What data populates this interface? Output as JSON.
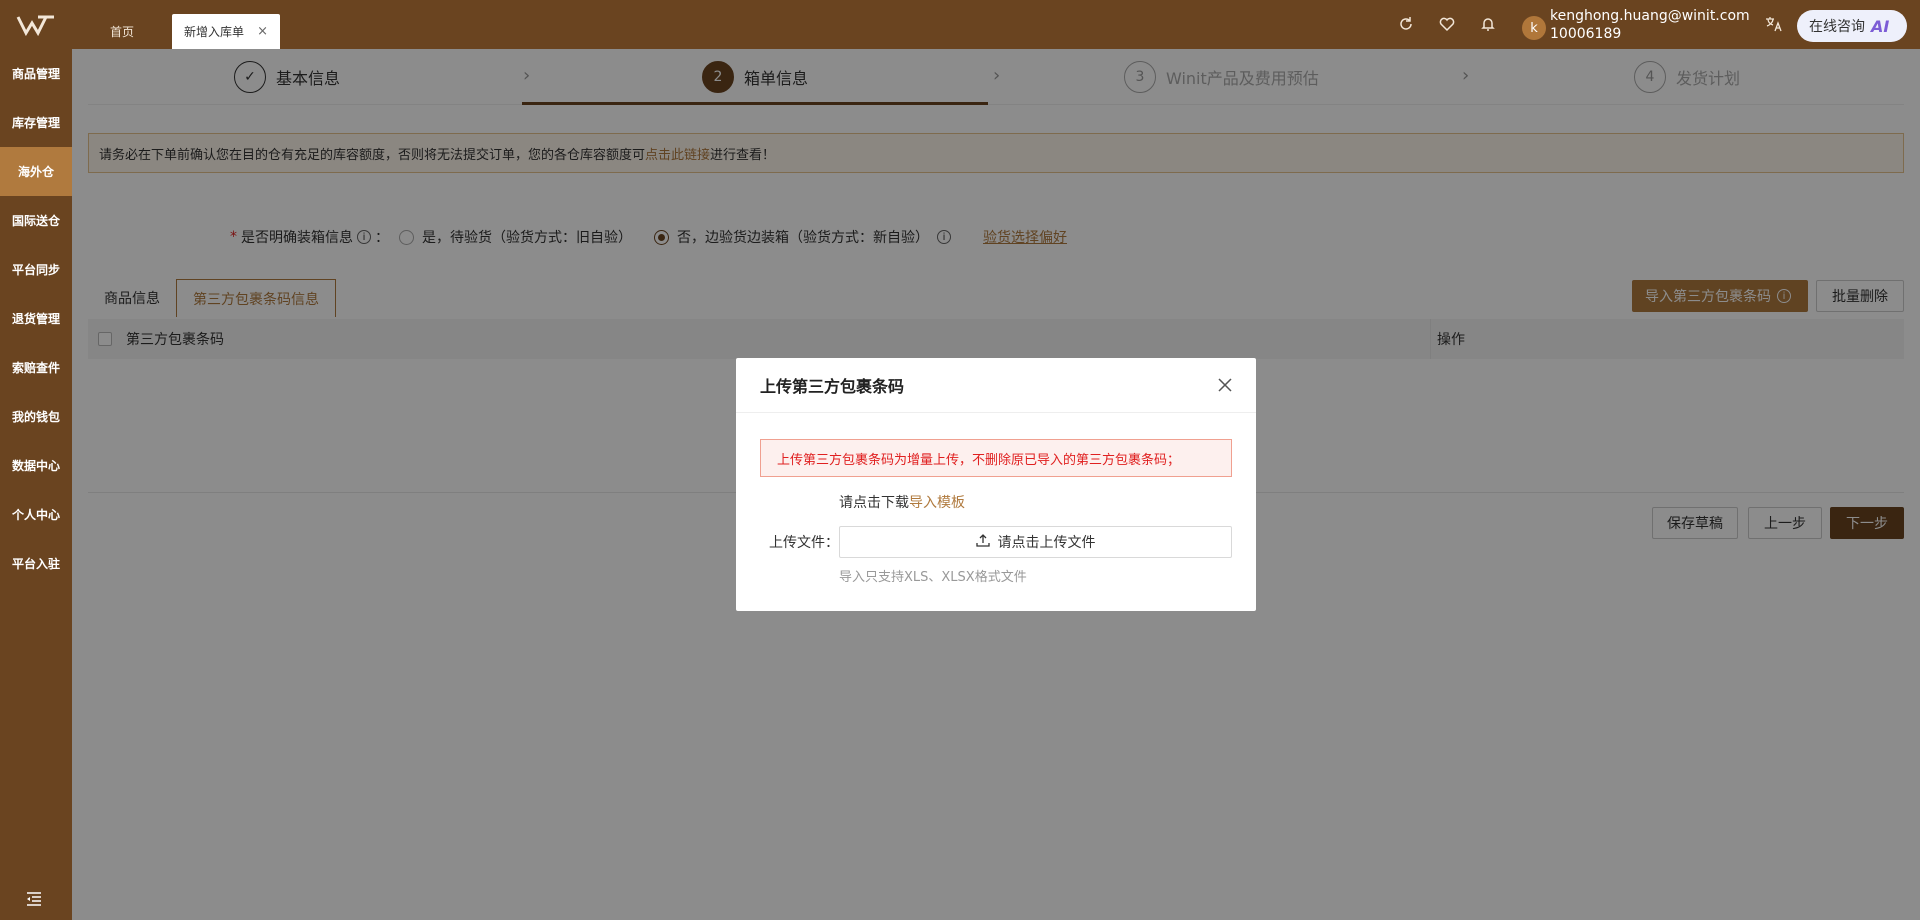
{
  "topbar": {
    "tabs": [
      {
        "label": "首页"
      },
      {
        "label": "新增入库单",
        "close": "×"
      }
    ],
    "user": {
      "avatar_letter": "k",
      "email": "kenghong.huang@winit.com",
      "id": "10006189"
    },
    "ai_button": {
      "label": "在线咨询",
      "badge": "AI"
    }
  },
  "sidebar": {
    "items": [
      {
        "label": "商品管理"
      },
      {
        "label": "库存管理"
      },
      {
        "label": "海外仓"
      },
      {
        "label": "国际送仓"
      },
      {
        "label": "平台同步"
      },
      {
        "label": "退货管理"
      },
      {
        "label": "索赔查件"
      },
      {
        "label": "我的钱包"
      },
      {
        "label": "数据中心"
      },
      {
        "label": "个人中心"
      },
      {
        "label": "平台入驻"
      }
    ]
  },
  "steps": [
    {
      "num": "✓",
      "label": "基本信息"
    },
    {
      "num": "2",
      "label": "箱单信息"
    },
    {
      "num": "3",
      "label": "Winit产品及费用预估"
    },
    {
      "num": "4",
      "label": "发货计划"
    }
  ],
  "notice": {
    "before": "请务必在下单前确认您在目的仓有充足的库容额度，否则将无法提交订单，您的各仓库容额度可",
    "link": "点击此链接",
    "after": "进行查看！"
  },
  "packing": {
    "required_mark": "*",
    "label": "是否明确装箱信息",
    "colon": "：",
    "option_yes": "是，待验货（验货方式：旧自验）",
    "option_no": "否，边验货边装箱（验货方式：新自验）",
    "pref_link": "验货选择偏好"
  },
  "subtabs": {
    "product_info": "商品信息",
    "barcode_info": "第三方包裹条码信息"
  },
  "actions": {
    "import_barcode": "导入第三方包裹条码",
    "batch_delete": "批量删除",
    "save_draft": "保存草稿",
    "prev": "上一步",
    "next": "下一步"
  },
  "table": {
    "col_barcode": "第三方包裹条码",
    "col_op": "操作"
  },
  "modal": {
    "title": "上传第三方包裹条码",
    "warning": "上传第三方包裹条码为增量上传，不删除原已导入的第三方包裹条码；",
    "template_prefix": "请点击下载",
    "template_link": "导入模板",
    "upload_label": "上传文件：",
    "upload_button": "请点击上传文件",
    "upload_hint": "导入只支持XLS、XLSX格式文件"
  }
}
